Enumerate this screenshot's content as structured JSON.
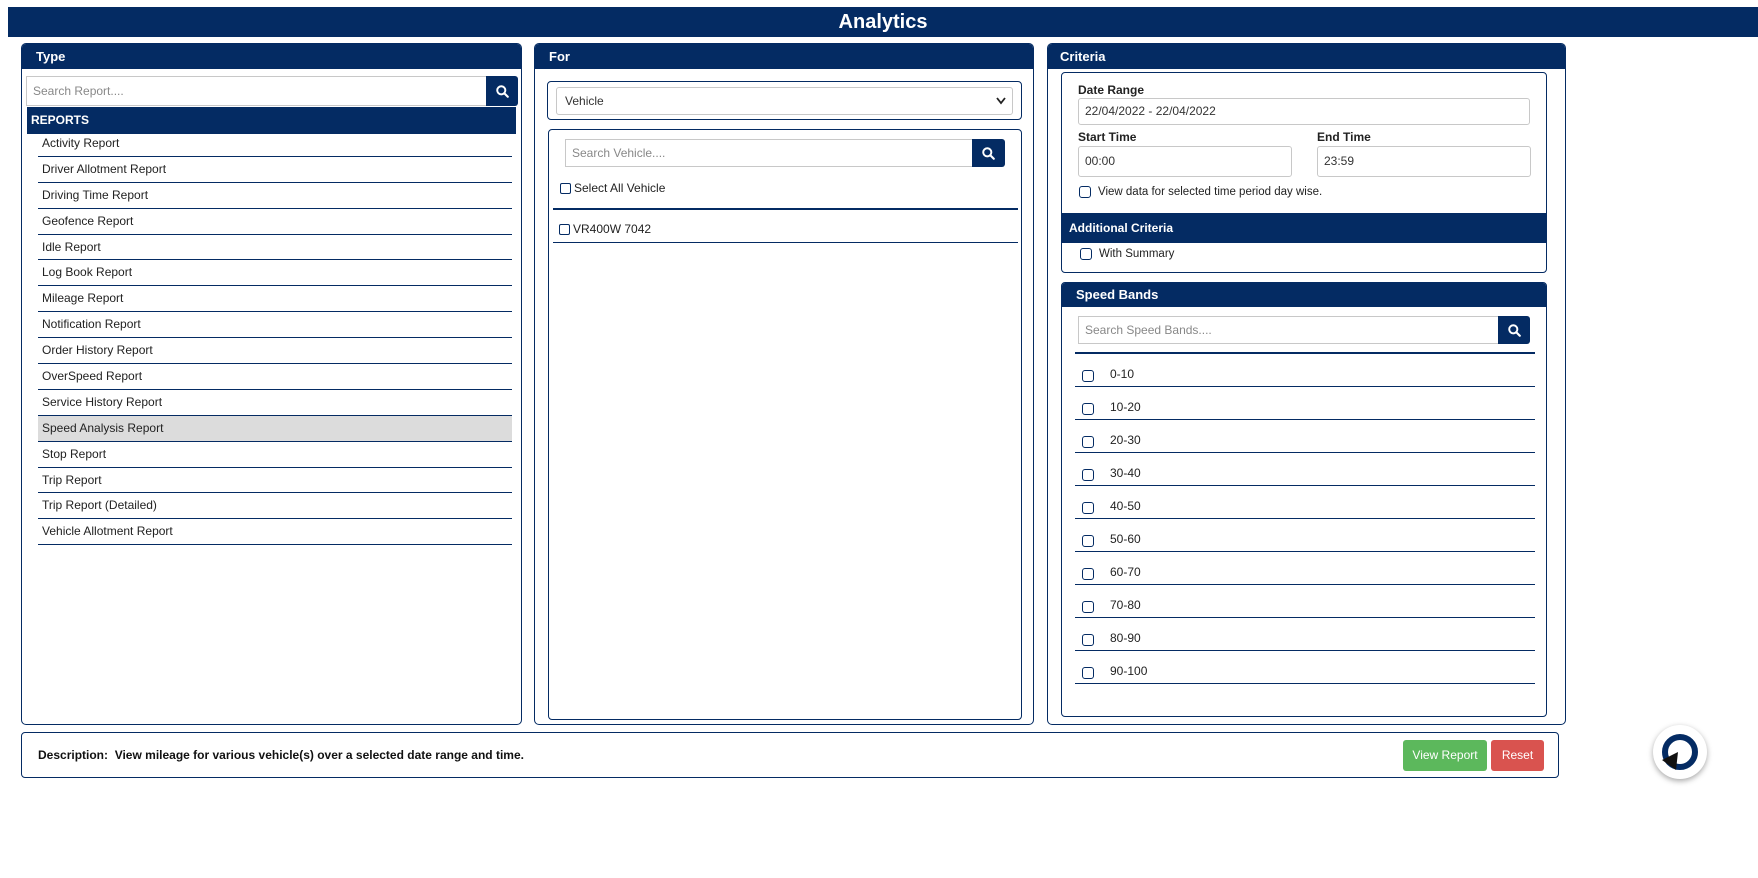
{
  "app": {
    "title": "Analytics"
  },
  "type_panel": {
    "header": "Type",
    "search_placeholder": "Search Report....",
    "reports_header": "REPORTS",
    "reports": [
      "Activity Report",
      "Driver Allotment Report",
      "Driving Time Report",
      "Geofence Report",
      "Idle Report",
      "Log Book Report",
      "Mileage Report",
      "Notification Report",
      "Order History Report",
      "OverSpeed Report",
      "Service History Report",
      "Speed Analysis Report",
      "Stop Report",
      "Trip Report",
      "Trip Report (Detailed)",
      "Vehicle Allotment Report"
    ],
    "selected_report": "Speed Analysis Report"
  },
  "for_panel": {
    "header": "For",
    "select_value": "Vehicle",
    "search_placeholder": "Search Vehicle....",
    "select_all_label": "Select All Vehicle",
    "vehicles": [
      "VR400W 7042"
    ]
  },
  "criteria_panel": {
    "header": "Criteria",
    "date_range_label": "Date Range",
    "date_range_value": "22/04/2022 - 22/04/2022",
    "start_time_label": "Start Time",
    "start_time_value": "00:00",
    "end_time_label": "End Time",
    "end_time_value": "23:59",
    "day_wise_label": "View data for selected time period day wise.",
    "additional_header": "Additional Criteria",
    "with_summary_label": "With Summary"
  },
  "speed_bands": {
    "header": "Speed Bands",
    "search_placeholder": "Search Speed Bands....",
    "bands": [
      "0-10",
      "10-20",
      "20-30",
      "30-40",
      "40-50",
      "50-60",
      "60-70",
      "70-80",
      "80-90",
      "90-100"
    ]
  },
  "footer": {
    "description_label": "Description:",
    "description_text": "View mileage for various vehicle(s) over a selected date range and time.",
    "view_report_label": "View Report",
    "reset_label": "Reset"
  },
  "colors": {
    "navy": "#042b63",
    "green": "#5cb85c",
    "red": "#d9534f",
    "selected": "#dcdcdc"
  },
  "icons": [
    "search-icon",
    "chevron-down-icon",
    "refresh-icon"
  ]
}
